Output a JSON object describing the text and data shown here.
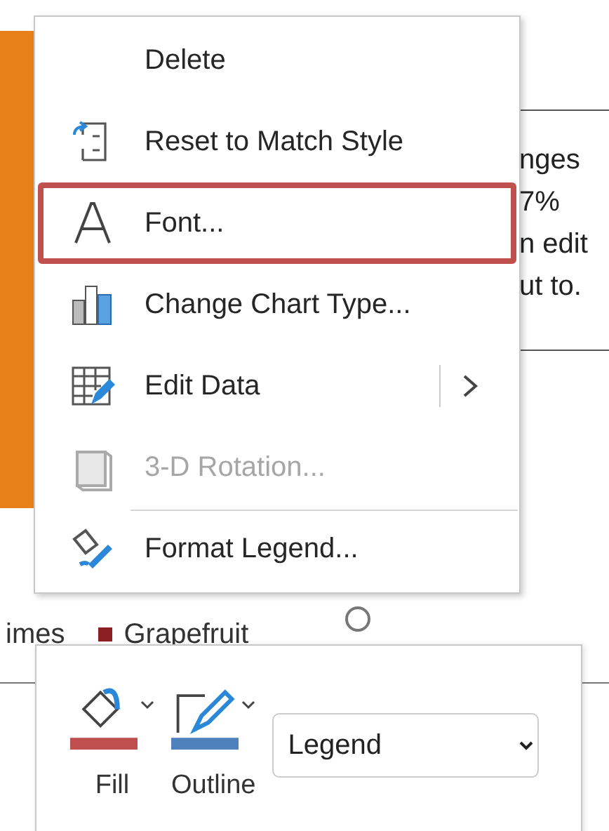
{
  "slide": {
    "text_lines": [
      "nges",
      "7%",
      "n edit",
      "ut to."
    ],
    "legend_items": [
      {
        "label": "imes"
      },
      {
        "label": "Grapefruit",
        "color": "#8b1f24"
      }
    ]
  },
  "context_menu": {
    "items": [
      {
        "label": "Delete",
        "selected": false,
        "disabled": false,
        "submenu": false,
        "separator_before": false
      },
      {
        "label": "Reset to Match Style",
        "selected": false,
        "disabled": false,
        "submenu": false,
        "separator_before": false
      },
      {
        "label": "Font...",
        "selected": true,
        "disabled": false,
        "submenu": false,
        "separator_before": false
      },
      {
        "label": "Change Chart Type...",
        "selected": false,
        "disabled": false,
        "submenu": false,
        "separator_before": false
      },
      {
        "label": "Edit Data",
        "selected": false,
        "disabled": false,
        "submenu": true,
        "separator_before": false
      },
      {
        "label": "3-D Rotation...",
        "selected": false,
        "disabled": true,
        "submenu": false,
        "separator_before": false
      },
      {
        "label": "Format Legend...",
        "selected": false,
        "disabled": false,
        "submenu": false,
        "separator_before": true
      }
    ]
  },
  "mini_toolbar": {
    "buttons": [
      {
        "label": "Fill",
        "color": "#c0504d"
      },
      {
        "label": "Outline",
        "color": "#4f81bd"
      }
    ],
    "element_select": {
      "value": "Legend"
    }
  }
}
